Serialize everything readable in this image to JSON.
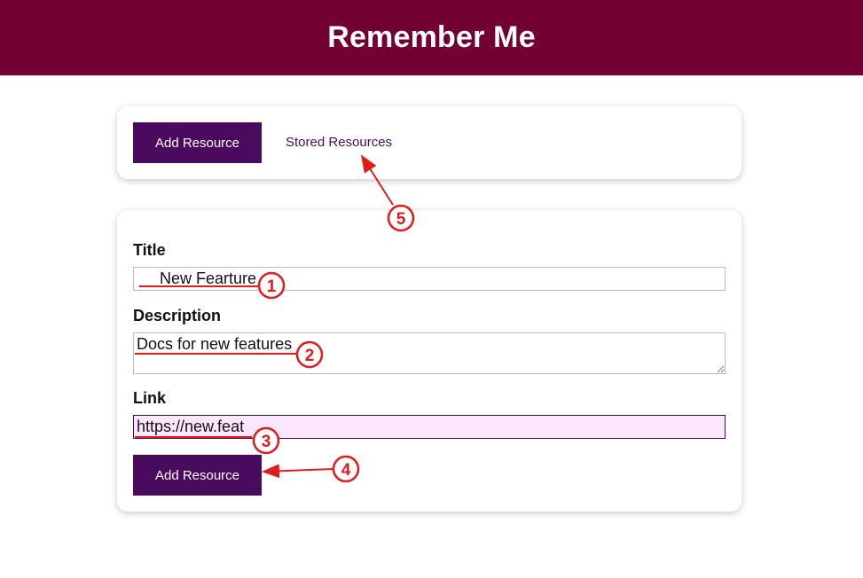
{
  "app": {
    "title": "Remember Me"
  },
  "nav": {
    "add_resource_label": "Add Resource",
    "stored_resources_label": "Stored Resources"
  },
  "form": {
    "title_label": "Title",
    "title_value": "New Fearture",
    "description_label": "Description",
    "description_value": "Docs for new features",
    "link_label": "Link",
    "link_value": "https://new.feat",
    "submit_label": "Add Resource"
  },
  "annotations": {
    "color": "#e11a1a",
    "markers": [
      "1",
      "2",
      "3",
      "4",
      "5"
    ]
  },
  "colors": {
    "header_bg": "#720033",
    "button_bg": "#4a0a5e",
    "active_input_bg": "#fce6fd"
  }
}
